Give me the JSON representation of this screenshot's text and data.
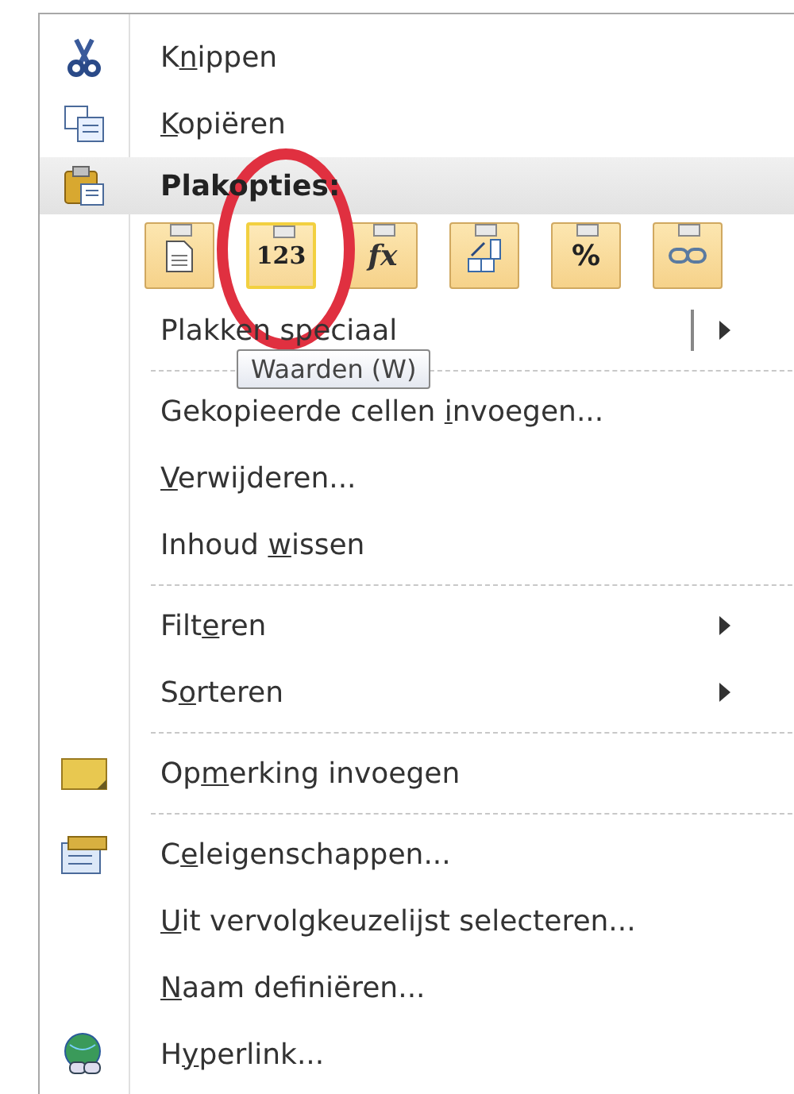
{
  "menu": {
    "items": [
      {
        "kind": "item",
        "label": {
          "before": "K",
          "key": "n",
          "after": "ippen"
        },
        "submenu": false
      },
      {
        "kind": "item",
        "label": {
          "key": "K",
          "after": "opiëren"
        },
        "submenu": false
      },
      {
        "kind": "header",
        "label": "Plakopties:"
      },
      {
        "kind": "paste_options",
        "buttons": [
          {
            "selected": false
          },
          {
            "label": "123",
            "selected": true
          },
          {
            "label": "fx",
            "selected": false
          },
          {
            "selected": false
          },
          {
            "label": "%",
            "selected": false
          },
          {
            "selected": false
          }
        ]
      },
      {
        "kind": "item",
        "label": {
          "before": "Plakken speciaal"
        },
        "submenu": true,
        "split": true
      },
      {
        "kind": "separator"
      },
      {
        "kind": "item",
        "label": {
          "before": "Gekopieerde cellen ",
          "key": "i",
          "after": "nvoegen..."
        },
        "submenu": false
      },
      {
        "kind": "item",
        "label": {
          "key": "V",
          "after": "erwijderen..."
        },
        "submenu": false
      },
      {
        "kind": "item",
        "label": {
          "before": "Inhoud ",
          "key": "w",
          "after": "issen"
        },
        "submenu": false
      },
      {
        "kind": "separator"
      },
      {
        "kind": "item",
        "label": {
          "before": "Filt",
          "key": "e",
          "after": "ren"
        },
        "submenu": true
      },
      {
        "kind": "item",
        "label": {
          "before": "S",
          "key": "o",
          "after": "rteren"
        },
        "submenu": true
      },
      {
        "kind": "separator"
      },
      {
        "kind": "item",
        "label": {
          "before": "Op",
          "key": "m",
          "after": "erking invoegen"
        },
        "submenu": false
      },
      {
        "kind": "separator"
      },
      {
        "kind": "item",
        "label": {
          "before": "C",
          "key": "e",
          "after": "leigenschappen..."
        },
        "submenu": false
      },
      {
        "kind": "item",
        "label": {
          "key": "U",
          "after": "it vervolgkeuzelijst selecteren..."
        },
        "submenu": false
      },
      {
        "kind": "item",
        "label": {
          "key": "N",
          "after": "aam definiëren..."
        },
        "submenu": false
      },
      {
        "kind": "item",
        "label": {
          "before": "H",
          "key": "y",
          "after": "perlink..."
        },
        "submenu": false
      }
    ]
  },
  "tooltip": {
    "text": "Waarden (W)"
  }
}
